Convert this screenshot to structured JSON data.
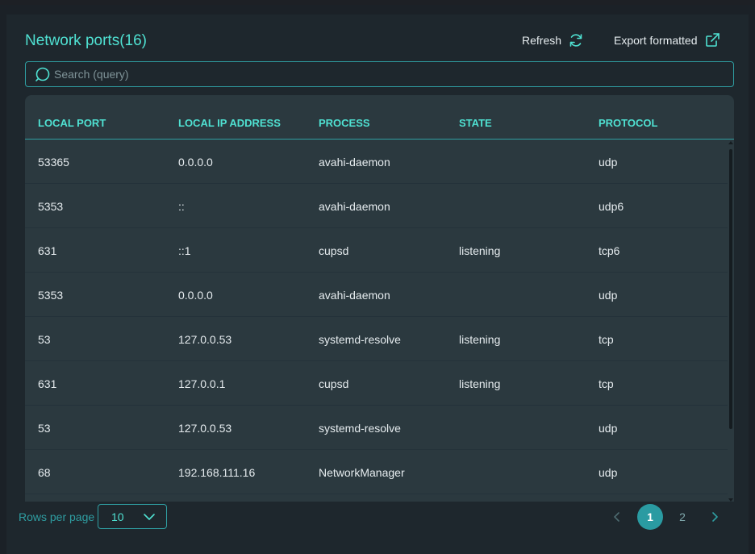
{
  "header": {
    "title": "Network ports(16)",
    "refresh_label": "Refresh",
    "export_label": "Export formatted"
  },
  "search": {
    "placeholder": "Search (query)",
    "value": ""
  },
  "table": {
    "columns": [
      "LOCAL PORT",
      "LOCAL IP ADDRESS",
      "PROCESS",
      "STATE",
      "PROTOCOL"
    ],
    "rows": [
      [
        "53365",
        "0.0.0.0",
        "avahi-daemon",
        "",
        "udp"
      ],
      [
        "5353",
        "::",
        "avahi-daemon",
        "",
        "udp6"
      ],
      [
        "631",
        "::1",
        "cupsd",
        "listening",
        "tcp6"
      ],
      [
        "5353",
        "0.0.0.0",
        "avahi-daemon",
        "",
        "udp"
      ],
      [
        "53",
        "127.0.0.53",
        "systemd-resolve",
        "listening",
        "tcp"
      ],
      [
        "631",
        "127.0.0.1",
        "cupsd",
        "listening",
        "tcp"
      ],
      [
        "53",
        "127.0.0.53",
        "systemd-resolve",
        "",
        "udp"
      ],
      [
        "68",
        "192.168.111.16",
        "NetworkManager",
        "",
        "udp"
      ]
    ]
  },
  "footer": {
    "rows_per_page_label": "Rows per page",
    "rows_per_page_value": "10",
    "pages": [
      "1",
      "2"
    ],
    "current_page": "1"
  },
  "icons": {
    "refresh": "refresh-icon",
    "export": "external-link-icon",
    "search": "search-icon",
    "chevron_down": "chevron-down-icon",
    "prev": "chevron-left-icon",
    "next": "chevron-right-icon"
  },
  "colors": {
    "accent": "#4fe1d2",
    "accent_dark": "#2f9ea2",
    "active_page": "#2a9ba2",
    "background": "#1e272d",
    "table_bg": "#2b393f",
    "text": "#e6ecef"
  }
}
